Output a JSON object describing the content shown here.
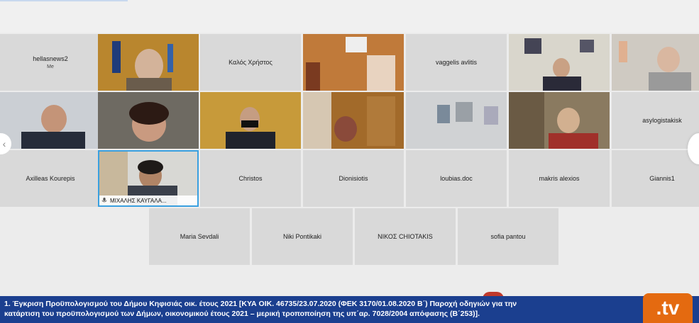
{
  "participants_row1": [
    {
      "name": "hellasnews2",
      "sub": "Me"
    },
    {
      "name": "",
      "video": true
    },
    {
      "name": "Καλός Χρήστος"
    },
    {
      "name": "",
      "video": true
    },
    {
      "name": "vaggelis avlitis"
    },
    {
      "name": "",
      "video": true
    },
    {
      "name": "",
      "video": true
    }
  ],
  "participants_row2": [
    {
      "name": "",
      "video": true
    },
    {
      "name": "",
      "video": true
    },
    {
      "name": "",
      "video": true
    },
    {
      "name": "",
      "video": true
    },
    {
      "name": "",
      "video": true
    },
    {
      "name": "",
      "video": true
    },
    {
      "name": "asylogistakisk"
    }
  ],
  "participants_row3": [
    {
      "name": "Axilleas Kourepis"
    },
    {
      "name": "",
      "video": true,
      "tag": "ΜΙΧΑΛΗΣ ΚΑΥΓΑΛΑ..."
    },
    {
      "name": "Christos"
    },
    {
      "name": "Dionisiotis"
    },
    {
      "name": "loubias.doc"
    },
    {
      "name": "makris alexios"
    },
    {
      "name": "Giannis1"
    }
  ],
  "participants_row4": [
    {
      "name": "Maria Sevdali"
    },
    {
      "name": "Niki Pontikaki"
    },
    {
      "name": "ΝΙΚΟΣ CHIOTAKIS"
    },
    {
      "name": "sofia pantou"
    }
  ],
  "nav": {
    "left_arrow": "‹"
  },
  "ticker": {
    "line1": "1.  Έγκριση Προϋπολογισμού του Δήμου Κηφισιάς οικ. έτους 2021 [ΚΥΑ ΟΙΚ. 46735/23.07.2020 (ΦΕΚ 3170/01.08.2020 Β΄) Παροχή οδηγιών για την",
    "line2": "κατάρτιση του προϋπολογισμού των Δήμων, οικονομικού έτους 2021 – μερική τροποποίηση της υπ΄αρ. 7028/2004 απόφασης (Β΄253)].",
    "logo": ".tv"
  },
  "colors": {
    "ticker_bg": "#1b3f8f",
    "logo_bg": "#e46a10",
    "active_border": "#3aa0e0"
  }
}
